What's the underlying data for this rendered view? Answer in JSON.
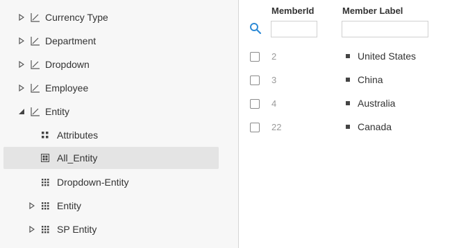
{
  "tree": {
    "items": [
      {
        "label": "Currency Type"
      },
      {
        "label": "Department"
      },
      {
        "label": "Dropdown"
      },
      {
        "label": "Employee"
      },
      {
        "label": "Entity"
      },
      {
        "label": "Attributes"
      },
      {
        "label": "All_Entity"
      },
      {
        "label": "Dropdown-Entity"
      },
      {
        "label": "Entity"
      },
      {
        "label": "SP Entity"
      }
    ]
  },
  "grid": {
    "columns": {
      "member_id": "MemberId",
      "member_label": "Member Label"
    },
    "filters": {
      "member_id": "",
      "member_label": ""
    },
    "rows": [
      {
        "id": "2",
        "label": "United States"
      },
      {
        "id": "3",
        "label": "China"
      },
      {
        "id": "4",
        "label": "Australia"
      },
      {
        "id": "22",
        "label": "Canada"
      }
    ]
  },
  "colors": {
    "accent": "#2f8bd6",
    "selected_bg": "#e4e4e4",
    "pane_bg": "#f7f7f7"
  }
}
